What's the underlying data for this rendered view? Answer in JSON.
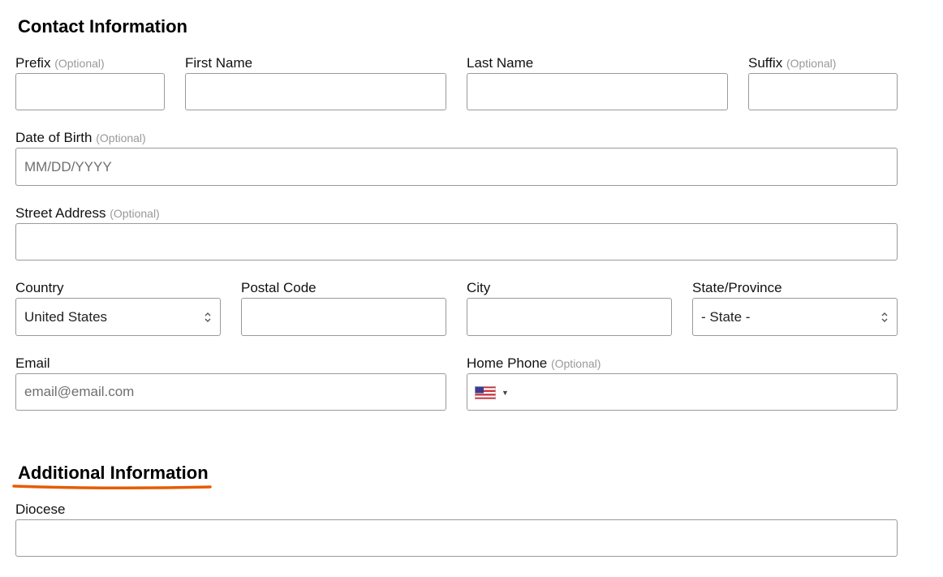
{
  "contact": {
    "heading": "Contact Information",
    "optional": "(Optional)",
    "prefix": {
      "label": "Prefix",
      "value": ""
    },
    "first_name": {
      "label": "First Name",
      "value": ""
    },
    "last_name": {
      "label": "Last Name",
      "value": ""
    },
    "suffix": {
      "label": "Suffix",
      "value": ""
    },
    "dob": {
      "label": "Date of Birth",
      "placeholder": "MM/DD/YYYY",
      "value": ""
    },
    "street": {
      "label": "Street Address",
      "value": ""
    },
    "country": {
      "label": "Country",
      "selected": "United States",
      "icon": "select-arrows-icon"
    },
    "postal": {
      "label": "Postal Code",
      "value": ""
    },
    "city": {
      "label": "City",
      "value": ""
    },
    "state": {
      "label": "State/Province",
      "selected": "- State -",
      "icon": "select-arrows-icon"
    },
    "email": {
      "label": "Email",
      "placeholder": "email@email.com",
      "value": ""
    },
    "home_phone": {
      "label": "Home Phone",
      "flag_icon": "us-flag-icon",
      "caret_icon": "caret-down-icon",
      "caret": "▼",
      "value": ""
    }
  },
  "additional": {
    "heading": "Additional Information",
    "underline_color": "#e65c00",
    "diocese": {
      "label": "Diocese",
      "value": ""
    }
  }
}
